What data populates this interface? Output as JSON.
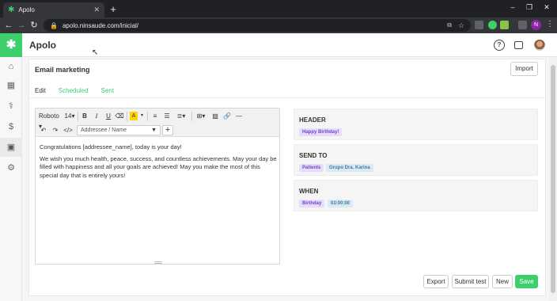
{
  "browser": {
    "tab_title": "Apolo",
    "tab_close": "✕",
    "new_tab": "+",
    "url": "apolo.ninsaude.com/inicial/",
    "profile_initial": "N",
    "win_min": "–",
    "win_max": "❐",
    "win_close": "✕"
  },
  "app": {
    "title": "Apolo",
    "accent": "#3ecf6d"
  },
  "page": {
    "title": "Email marketing",
    "import_label": "Import",
    "tabs": [
      "Edit",
      "Scheduled",
      "Sent"
    ]
  },
  "editor": {
    "font": "Roboto",
    "size": "14",
    "addressee_placeholder": "Addressee / Name",
    "paragraphs": [
      "Congratulations [addressee_name], today is your day!",
      "We wish you much health, peace, success, and countless achievements. May your day be filled with happiness and all your goals are achieved! May you make the most of this special day that is entirely yours!"
    ]
  },
  "panels": {
    "header": {
      "title": "HEADER",
      "tags": [
        "Happy Birthday!"
      ]
    },
    "send_to": {
      "title": "SEND TO",
      "tags": [
        "Patients",
        "Grupo Dra. Karina"
      ]
    },
    "when": {
      "title": "WHEN",
      "tags": [
        "Birthday",
        "03:00:00"
      ]
    }
  },
  "footer": {
    "export": "Export",
    "submit_test": "Submit test",
    "new": "New",
    "save": "Save"
  }
}
